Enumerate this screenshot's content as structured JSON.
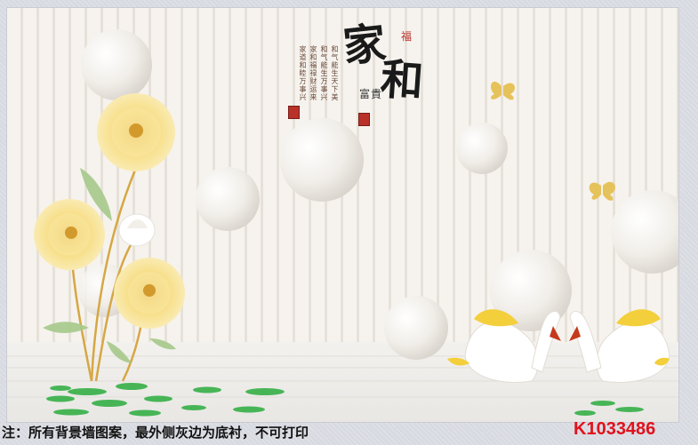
{
  "calligraphy": {
    "title_jia": "家",
    "title_he": "和",
    "seal_fu": "福",
    "fugui": "富貴",
    "poem_columns": [
      "和气能生天下美",
      "和气能生万事兴",
      "家和福禄财运来",
      "家道和睦万事兴"
    ]
  },
  "footer": {
    "note": "注：所有背景墙图案，最外侧灰边为底衬，不可打印",
    "product_code": "K1033486"
  },
  "colors": {
    "background": "#f4f1ec",
    "stripe": "#e7e2da",
    "sphere": "#f6f3ee",
    "flower": "#f5dc7c",
    "leaf": "#3fae4e",
    "code_red": "#e0121c"
  },
  "scene": {
    "spheres": 9,
    "flowers": [
      "yellow-peony",
      "yellow-peony",
      "yellow-peony",
      "white-lotus-bud"
    ],
    "butterflies": 2,
    "swans": 2
  }
}
